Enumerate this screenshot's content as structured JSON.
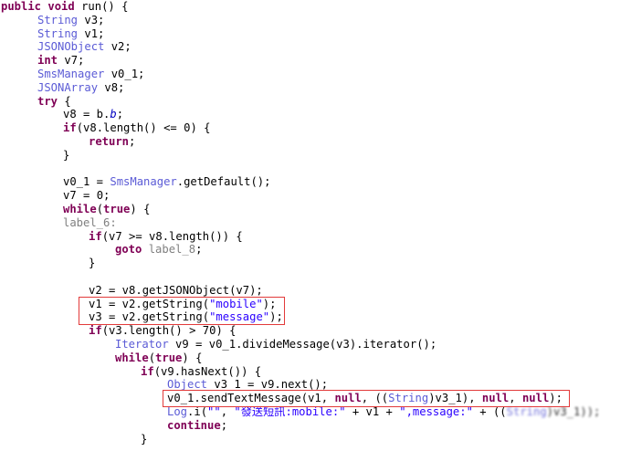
{
  "editor": {
    "lines": [
      {
        "indent": 1,
        "parts": [
          {
            "t": "public void ",
            "c": "kw"
          },
          {
            "t": "run() {",
            "c": "nm"
          }
        ]
      },
      {
        "indent": 41,
        "parts": [
          {
            "t": "String",
            "c": "ty"
          },
          {
            "t": " v3;",
            "c": "nm"
          }
        ]
      },
      {
        "indent": 41,
        "parts": [
          {
            "t": "String",
            "c": "ty"
          },
          {
            "t": " v1;",
            "c": "nm"
          }
        ]
      },
      {
        "indent": 41,
        "parts": [
          {
            "t": "JSONObject",
            "c": "ty"
          },
          {
            "t": " v2;",
            "c": "nm"
          }
        ]
      },
      {
        "indent": 41,
        "parts": [
          {
            "t": "int",
            "c": "kw"
          },
          {
            "t": " v7;",
            "c": "nm"
          }
        ]
      },
      {
        "indent": 41,
        "parts": [
          {
            "t": "SmsManager",
            "c": "ty"
          },
          {
            "t": " v0_1;",
            "c": "nm"
          }
        ]
      },
      {
        "indent": 41,
        "parts": [
          {
            "t": "JSONArray",
            "c": "ty"
          },
          {
            "t": " v8;",
            "c": "nm"
          }
        ]
      },
      {
        "indent": 41,
        "parts": [
          {
            "t": "try",
            "c": "kw"
          },
          {
            "t": " {",
            "c": "nm"
          }
        ]
      },
      {
        "indent": 69,
        "parts": [
          {
            "t": "v8 = b.",
            "c": "nm"
          },
          {
            "t": "b",
            "c": "fld"
          },
          {
            "t": ";",
            "c": "nm"
          }
        ]
      },
      {
        "indent": 69,
        "parts": [
          {
            "t": "if",
            "c": "kw"
          },
          {
            "t": "(v8.length() <= ",
            "c": "nm"
          },
          {
            "t": "0",
            "c": "nm"
          },
          {
            "t": ") {",
            "c": "nm"
          }
        ]
      },
      {
        "indent": 97,
        "parts": [
          {
            "t": "return",
            "c": "kw"
          },
          {
            "t": ";",
            "c": "nm"
          }
        ]
      },
      {
        "indent": 69,
        "parts": [
          {
            "t": "}",
            "c": "nm"
          }
        ]
      },
      {
        "indent": 69,
        "parts": [
          {
            "t": "",
            "c": "nm"
          }
        ]
      },
      {
        "indent": 69,
        "parts": [
          {
            "t": "v0_1 = ",
            "c": "nm"
          },
          {
            "t": "SmsManager",
            "c": "ty"
          },
          {
            "t": ".getDefault();",
            "c": "nm"
          }
        ]
      },
      {
        "indent": 69,
        "parts": [
          {
            "t": "v7 = ",
            "c": "nm"
          },
          {
            "t": "0",
            "c": "nm"
          },
          {
            "t": ";",
            "c": "nm"
          }
        ]
      },
      {
        "indent": 69,
        "parts": [
          {
            "t": "while",
            "c": "kw"
          },
          {
            "t": "(",
            "c": "nm"
          },
          {
            "t": "true",
            "c": "kw"
          },
          {
            "t": ") {",
            "c": "nm"
          }
        ]
      },
      {
        "indent": 69,
        "parts": [
          {
            "t": "label_6:",
            "c": "lb"
          }
        ]
      },
      {
        "indent": 97,
        "parts": [
          {
            "t": "if",
            "c": "kw"
          },
          {
            "t": "(v7 >= v8.length()) {",
            "c": "nm"
          }
        ]
      },
      {
        "indent": 126,
        "parts": [
          {
            "t": "goto",
            "c": "kw"
          },
          {
            "t": " ",
            "c": "nm"
          },
          {
            "t": "label_8",
            "c": "lb"
          },
          {
            "t": ";",
            "c": "nm"
          }
        ]
      },
      {
        "indent": 97,
        "parts": [
          {
            "t": "}",
            "c": "nm"
          }
        ]
      },
      {
        "indent": 97,
        "parts": [
          {
            "t": "",
            "c": "nm"
          }
        ]
      },
      {
        "indent": 97,
        "parts": [
          {
            "t": "v2 = v8.getJSONObject(v7);",
            "c": "nm"
          }
        ]
      },
      {
        "indent": 97,
        "parts": [
          {
            "t": "v1 = v2.getString(",
            "c": "nm"
          },
          {
            "t": "\"mobile\"",
            "c": "st"
          },
          {
            "t": ");",
            "c": "nm"
          }
        ]
      },
      {
        "indent": 97,
        "parts": [
          {
            "t": "v3 = v2.getString(",
            "c": "nm"
          },
          {
            "t": "\"message\"",
            "c": "st"
          },
          {
            "t": ");",
            "c": "nm"
          }
        ]
      },
      {
        "indent": 97,
        "parts": [
          {
            "t": "if",
            "c": "kw"
          },
          {
            "t": "(v3.length() > ",
            "c": "nm"
          },
          {
            "t": "70",
            "c": "nm"
          },
          {
            "t": ") {",
            "c": "nm"
          }
        ]
      },
      {
        "indent": 126,
        "parts": [
          {
            "t": "Iterator",
            "c": "ty"
          },
          {
            "t": " v9 = v0_1.divideMessage(v3).iterator();",
            "c": "nm"
          }
        ]
      },
      {
        "indent": 126,
        "parts": [
          {
            "t": "while",
            "c": "kw"
          },
          {
            "t": "(",
            "c": "nm"
          },
          {
            "t": "true",
            "c": "kw"
          },
          {
            "t": ") {",
            "c": "nm"
          }
        ]
      },
      {
        "indent": 154,
        "parts": [
          {
            "t": "if",
            "c": "kw"
          },
          {
            "t": "(v9.hasNext()) {",
            "c": "nm"
          }
        ]
      },
      {
        "indent": 183,
        "parts": [
          {
            "t": "Object",
            "c": "ty"
          },
          {
            "t": " v3_1 = v9.next();",
            "c": "nm"
          }
        ]
      },
      {
        "indent": 183,
        "parts": [
          {
            "t": "v0_1.sendTextMessage(v1, ",
            "c": "nm"
          },
          {
            "t": "null",
            "c": "kw"
          },
          {
            "t": ", ((",
            "c": "nm"
          },
          {
            "t": "String",
            "c": "ty"
          },
          {
            "t": ")v3_1), ",
            "c": "nm"
          },
          {
            "t": "null",
            "c": "kw"
          },
          {
            "t": ", ",
            "c": "nm"
          },
          {
            "t": "null",
            "c": "kw"
          },
          {
            "t": ");",
            "c": "nm"
          }
        ]
      },
      {
        "indent": 183,
        "parts": [
          {
            "t": "Log",
            "c": "ty"
          },
          {
            "t": ".i(",
            "c": "nm"
          },
          {
            "t": "\"\"",
            "c": "st"
          },
          {
            "t": ", ",
            "c": "nm"
          },
          {
            "t": "\"發送短訊:mobile:\"",
            "c": "st"
          },
          {
            "t": " + v1 + ",
            "c": "nm"
          },
          {
            "t": "\",message:\"",
            "c": "st"
          },
          {
            "t": " + ((",
            "c": "nm"
          },
          {
            "t": "String",
            "c": "ty"
          },
          {
            "t": ")v3_1));",
            "c": "nm"
          }
        ]
      },
      {
        "indent": 183,
        "parts": [
          {
            "t": "continue",
            "c": "kw"
          },
          {
            "t": ";",
            "c": "nm"
          }
        ]
      },
      {
        "indent": 154,
        "parts": [
          {
            "t": "}",
            "c": "nm"
          }
        ]
      }
    ],
    "highlights": [
      {
        "name": "highlight-getstring-box",
        "note": ""
      },
      {
        "name": "highlight-send-sms-box",
        "note": ""
      }
    ]
  }
}
